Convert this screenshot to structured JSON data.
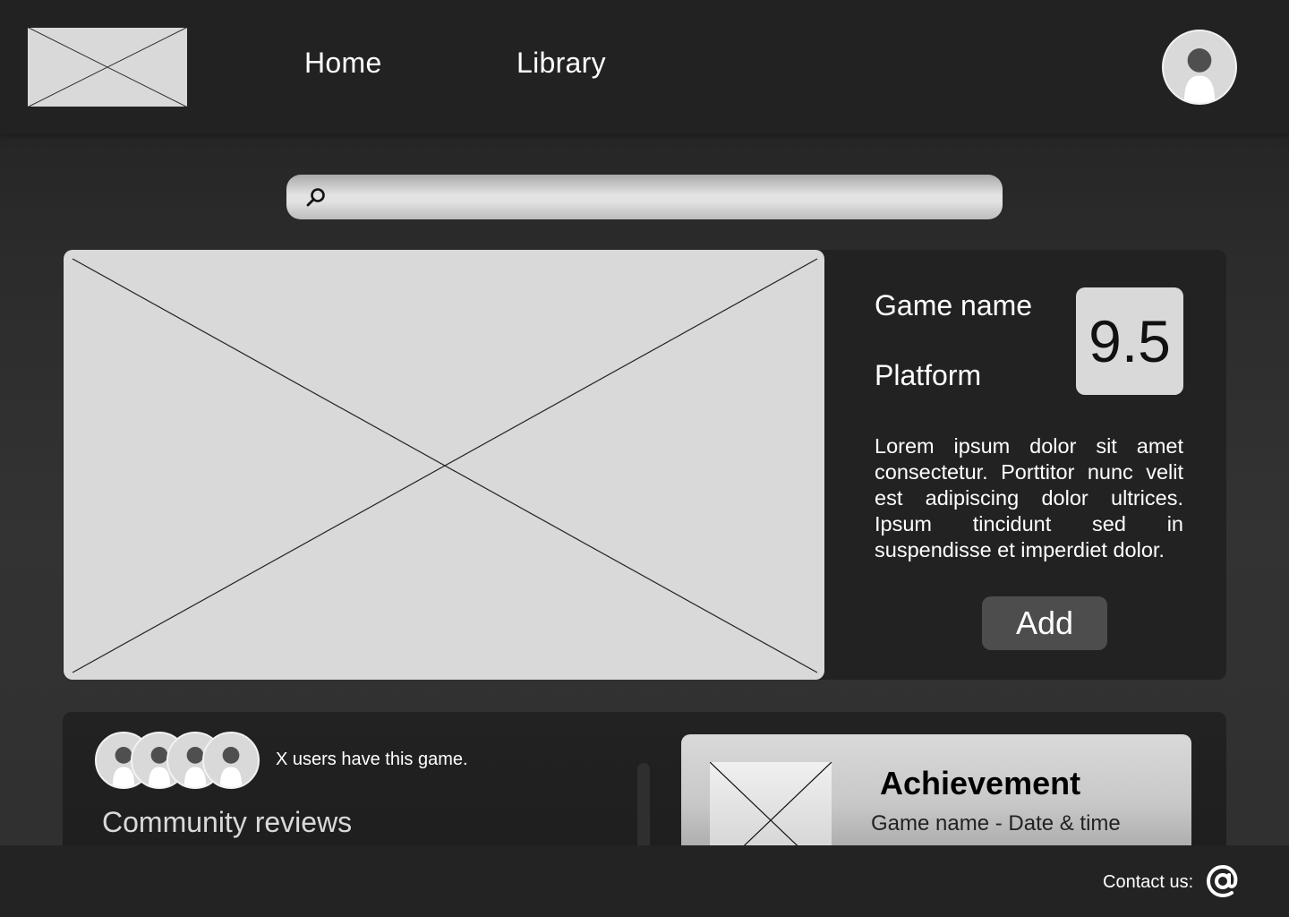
{
  "header": {
    "nav": [
      {
        "label": "Home"
      },
      {
        "label": "Library"
      }
    ]
  },
  "search": {
    "placeholder": "",
    "value": ""
  },
  "game": {
    "name": "Game name",
    "platform": "Platform",
    "score": "9.5",
    "description": "Lorem ipsum dolor sit amet consectetur. Porttitor nunc velit est adipiscing dolor ultrices. Ipsum tincidunt sed in suspendisse et imperdiet dolor.",
    "add_label": "Add"
  },
  "community": {
    "users_text": "X users have this game.",
    "reviews_title": "Community reviews"
  },
  "achievement": {
    "title": "Achievement",
    "subtitle": "Game name - Date & time"
  },
  "footer": {
    "contact_label": "Contact us:"
  },
  "colors": {
    "header_bg": "#222222",
    "panel_bg": "#222222",
    "placeholder": "#d9d9d9",
    "button_bg": "#4d4d4d"
  },
  "icons": {
    "search": "search-icon",
    "avatar": "user-avatar-icon",
    "contact": "at-sign-icon"
  }
}
